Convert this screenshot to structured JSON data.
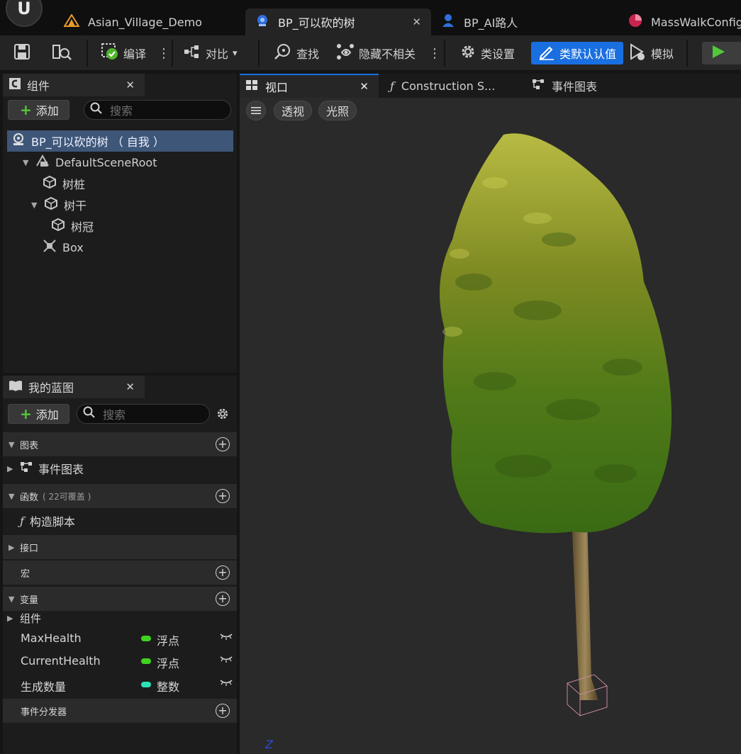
{
  "tabs": [
    {
      "label": "Asian_Village_Demo",
      "active": false
    },
    {
      "label": "BP_可以砍的树",
      "active": true
    },
    {
      "label": "BP_AI路人",
      "active": false
    },
    {
      "label": "MassWalkConfig",
      "active": false
    }
  ],
  "toolbar": {
    "compile": "编译",
    "diff": "对比",
    "find": "查找",
    "hide_unrelated": "隐藏不相关",
    "class_settings": "类设置",
    "class_defaults": "类默认认值",
    "simulate": "模拟"
  },
  "components": {
    "title": "组件",
    "add_label": "添加",
    "search_placeholder": "搜索",
    "tree": [
      {
        "label": "BP_可以砍的树 （ 自我 ）",
        "selected": true
      },
      {
        "label": "DefaultSceneRoot"
      },
      {
        "label": "树桩"
      },
      {
        "label": "树干"
      },
      {
        "label": "树冠"
      },
      {
        "label": "Box"
      }
    ]
  },
  "my_blueprint": {
    "title": "我的蓝图",
    "add_label": "添加",
    "search_placeholder": "搜索",
    "sections": {
      "graphs": "图表",
      "event_graph": "事件图表",
      "functions": "函数",
      "functions_sub": "( 22可覆盖 )",
      "construction_script": "构造脚本",
      "interfaces": "接口",
      "macros": "宏",
      "variables": "变量",
      "components_group": "组件",
      "event_dispatchers": "事件分发器"
    },
    "variables": [
      {
        "name": "MaxHealth",
        "type": "浮点",
        "color": "#3fd21f"
      },
      {
        "name": "CurrentHealth",
        "type": "浮点",
        "color": "#3fd21f"
      },
      {
        "name": "生成数量",
        "type": "整数",
        "color": "#2ee0b5"
      }
    ]
  },
  "viewport_tabs": [
    {
      "label": "视口",
      "active": true
    },
    {
      "label": "Construction S...",
      "active": false
    },
    {
      "label": "事件图表",
      "active": false
    }
  ],
  "viewport": {
    "menu_icon": "hamburger-icon",
    "perspective": "透视",
    "lighting": "光照",
    "axis_label": "Z"
  },
  "colors": {
    "accent": "#1a6fe0",
    "selection": "#3e5678",
    "add_plus": "#53c83c"
  }
}
